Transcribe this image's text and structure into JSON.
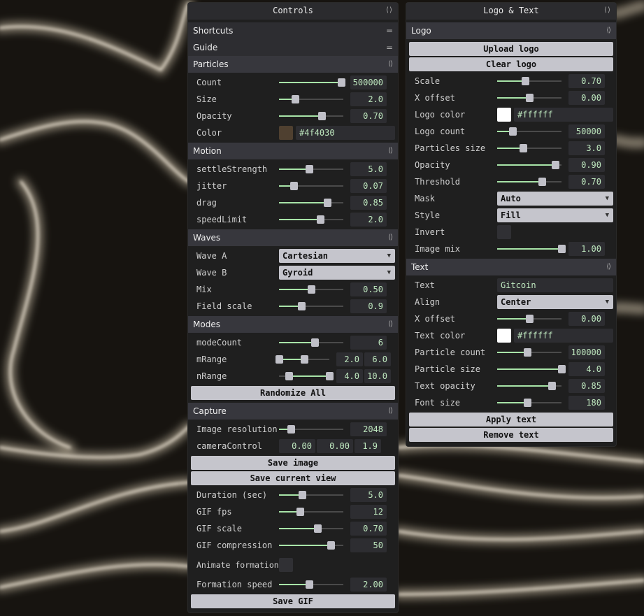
{
  "controls": {
    "title": "Controls",
    "shortcuts_label": "Shortcuts",
    "guide_label": "Guide",
    "particles": {
      "title": "Particles",
      "count": {
        "label": "Count",
        "value": "500000",
        "pct": 0.97
      },
      "size": {
        "label": "Size",
        "value": "2.0",
        "pct": 0.25
      },
      "opacity": {
        "label": "Opacity",
        "value": "0.70",
        "pct": 0.66
      },
      "color": {
        "label": "Color",
        "value": "#4f4030",
        "swatch": "#4f4030"
      }
    },
    "motion": {
      "title": "Motion",
      "settle": {
        "label": "settleStrength",
        "value": "5.0",
        "pct": 0.47
      },
      "jitter": {
        "label": "jitter",
        "value": "0.07",
        "pct": 0.23
      },
      "drag": {
        "label": "drag",
        "value": "0.85",
        "pct": 0.75
      },
      "speed": {
        "label": "speedLimit",
        "value": "2.0",
        "pct": 0.64
      }
    },
    "waves": {
      "title": "Waves",
      "wave_a": {
        "label": "Wave A",
        "value": "Cartesian"
      },
      "wave_b": {
        "label": "Wave B",
        "value": "Gyroid"
      },
      "mix": {
        "label": "Mix",
        "value": "0.50",
        "pct": 0.5
      },
      "field": {
        "label": "Field scale",
        "value": "0.9",
        "pct": 0.35
      }
    },
    "modes": {
      "title": "Modes",
      "modecount": {
        "label": "modeCount",
        "value": "6",
        "pct": 0.55
      },
      "mrange": {
        "label": "mRange",
        "v1": "2.0",
        "v2": "6.0"
      },
      "nrange": {
        "label": "nRange",
        "v1": "4.0",
        "v2": "10.0"
      },
      "randomize": "Randomize All"
    },
    "capture": {
      "title": "Capture",
      "resolution": {
        "label": "Image resolution",
        "value": "2048",
        "pct": 0.18
      },
      "camera": {
        "label": "cameraControl",
        "v1": "0.00",
        "v2": "0.00",
        "v3": "1.9"
      },
      "save_image": "Save image",
      "save_view": "Save current view",
      "duration": {
        "label": "Duration (sec)",
        "value": "5.0",
        "pct": 0.36
      },
      "fps": {
        "label": "GIF fps",
        "value": "12",
        "pct": 0.33
      },
      "scale": {
        "label": "GIF scale",
        "value": "0.70",
        "pct": 0.6
      },
      "compression": {
        "label": "GIF compression",
        "value": "50",
        "pct": 0.8
      },
      "animate": {
        "label": "Animate formation"
      },
      "formation_speed": {
        "label": "Formation speed",
        "value": "2.00",
        "pct": 0.47
      },
      "save_gif": "Save GIF"
    }
  },
  "logotext": {
    "title": "Logo & Text",
    "logo": {
      "title": "Logo",
      "upload": "Upload logo",
      "clear": "Clear logo",
      "scale": {
        "label": "Scale",
        "value": "0.70",
        "pct": 0.43
      },
      "xoffset": {
        "label": "X offset",
        "value": "0.00",
        "pct": 0.5
      },
      "color": {
        "label": "Logo color",
        "value": "#ffffff",
        "swatch": "#ffffff"
      },
      "count": {
        "label": "Logo count",
        "value": "50000",
        "pct": 0.24
      },
      "psize": {
        "label": "Particles size",
        "value": "3.0",
        "pct": 0.4
      },
      "opacity": {
        "label": "Opacity",
        "value": "0.90",
        "pct": 0.9
      },
      "threshold": {
        "label": "Threshold",
        "value": "0.70",
        "pct": 0.7
      },
      "mask": {
        "label": "Mask",
        "value": "Auto"
      },
      "style": {
        "label": "Style",
        "value": "Fill"
      },
      "invert": {
        "label": "Invert"
      },
      "imagemix": {
        "label": "Image mix",
        "value": "1.00",
        "pct": 1.0
      }
    },
    "text": {
      "title": "Text",
      "text": {
        "label": "Text",
        "value": "Gitcoin"
      },
      "align": {
        "label": "Align",
        "value": "Center"
      },
      "xoffset": {
        "label": "X offset",
        "value": "0.00",
        "pct": 0.5
      },
      "color": {
        "label": "Text color",
        "value": "#ffffff",
        "swatch": "#ffffff"
      },
      "pcount": {
        "label": "Particle count",
        "value": "100000",
        "pct": 0.47
      },
      "psize": {
        "label": "Particle size",
        "value": "4.0",
        "pct": 1.0
      },
      "opacity": {
        "label": "Text opacity",
        "value": "0.85",
        "pct": 0.85
      },
      "fontsize": {
        "label": "Font size",
        "value": "180",
        "pct": 0.47
      },
      "apply": "Apply text",
      "remove": "Remove text"
    }
  },
  "icons": {
    "collapse": "collapse-icon",
    "menu": "menu-icon",
    "caret": "caret-down-icon"
  },
  "colors": {
    "accent": "#a8e4a8",
    "particle": "#f1e6cf",
    "background": "#171410"
  }
}
